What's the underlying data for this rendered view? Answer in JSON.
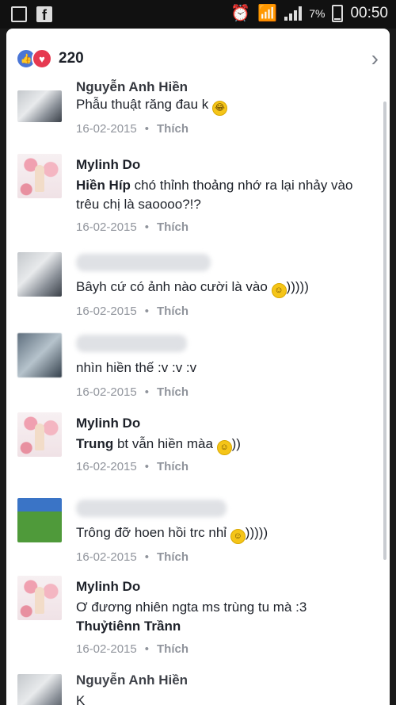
{
  "statusbar": {
    "battery_text": "7%",
    "time": "00:50",
    "icons": [
      "gallery-icon",
      "facebook-icon",
      "alarm-icon",
      "wifi-icon",
      "signal-icon",
      "battery-icon"
    ]
  },
  "header": {
    "reaction_count": "220",
    "reactions": [
      "like",
      "love"
    ]
  },
  "comments": [
    {
      "author": "Nguyễn Anh Hiền",
      "text": "Phẫu thuật răng đau k",
      "date": "16-02-2015",
      "action": "Thích"
    },
    {
      "author": "Mylinh Do",
      "mention": "Hiền Híp",
      "text": " chó thỉnh thoảng nhớ ra lại nhảy vào trêu chị là saoooo?!?",
      "date": "16-02-2015",
      "action": "Thích"
    },
    {
      "author": "",
      "text": "Bâyh cứ có ảnh nào cười là vào ",
      "suffix": ")))))",
      "date": "16-02-2015",
      "action": "Thích"
    },
    {
      "author": "",
      "text": "nhìn hiền thế :v :v :v",
      "date": "16-02-2015",
      "action": "Thích"
    },
    {
      "author": "Mylinh Do",
      "mention": "Trung",
      "text": " bt vẫn hiền màa ",
      "suffix": "))",
      "date": "16-02-2015",
      "action": "Thích"
    },
    {
      "author": "",
      "text": "Trông đỡ hoen hồi trc nhỉ ",
      "suffix": ")))))",
      "date": "16-02-2015",
      "action": "Thích"
    },
    {
      "author": "Mylinh Do",
      "text": "Ơ đương nhiên ngta ms trùng tu mà :3",
      "mention2": "Thuỷtiênn Trầnn",
      "date": "16-02-2015",
      "action": "Thích"
    },
    {
      "author": "Nguyễn Anh Hiền",
      "text": "K"
    }
  ]
}
